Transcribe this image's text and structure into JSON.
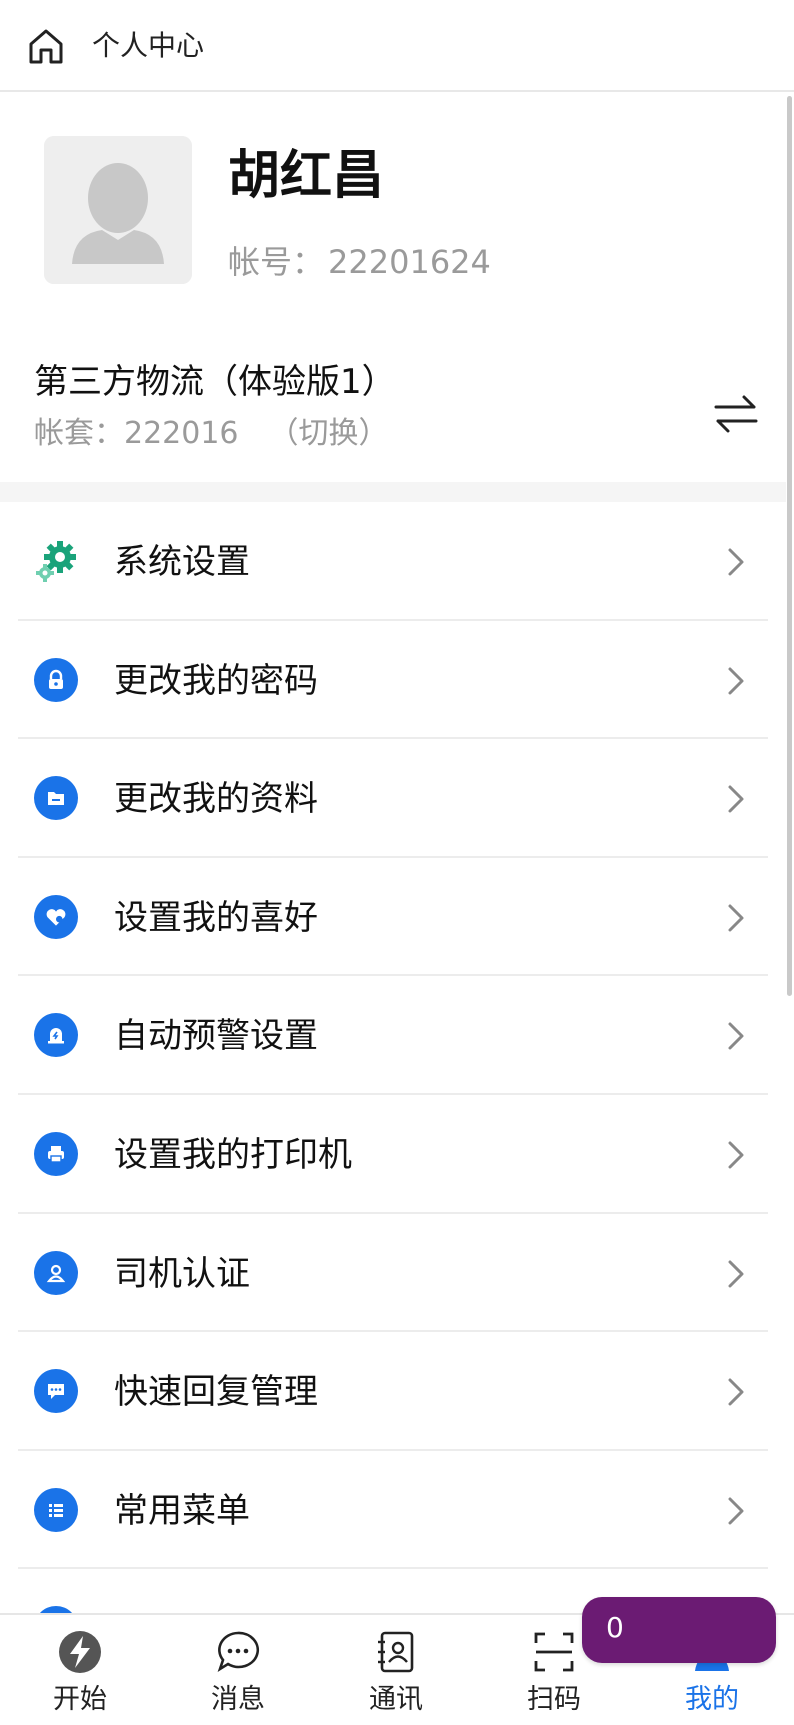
{
  "header": {
    "title": "个人中心"
  },
  "profile": {
    "name": "胡红昌",
    "account_label": "帐号：",
    "account_value": "22201624"
  },
  "company": {
    "name": "第三方物流（体验版1）",
    "ledger_label": "帐套：",
    "ledger_value": "222016",
    "switch_label": "（切换）"
  },
  "menu": {
    "items": [
      {
        "label": "系统设置",
        "icon": "gear-icon"
      },
      {
        "label": "更改我的密码",
        "icon": "lock-icon"
      },
      {
        "label": "更改我的资料",
        "icon": "folder-icon"
      },
      {
        "label": "设置我的喜好",
        "icon": "heart-icon"
      },
      {
        "label": "自动预警设置",
        "icon": "alert-icon"
      },
      {
        "label": "设置我的打印机",
        "icon": "printer-icon"
      },
      {
        "label": "司机认证",
        "icon": "driver-icon"
      },
      {
        "label": "快速回复管理",
        "icon": "chat-icon"
      },
      {
        "label": "常用菜单",
        "icon": "list-icon"
      }
    ]
  },
  "nav": {
    "tabs": [
      {
        "label": "开始",
        "icon": "lightning-logo-icon"
      },
      {
        "label": "消息",
        "icon": "message-icon"
      },
      {
        "label": "通讯",
        "icon": "contacts-icon"
      },
      {
        "label": "扫码",
        "icon": "scan-icon"
      },
      {
        "label": "我的",
        "icon": "user-icon",
        "active": true
      }
    ]
  },
  "floating_badge": {
    "count": "0"
  },
  "colors": {
    "accent": "#1a73e8",
    "gear": "#1aa37a",
    "badge": "#6b1b73"
  }
}
